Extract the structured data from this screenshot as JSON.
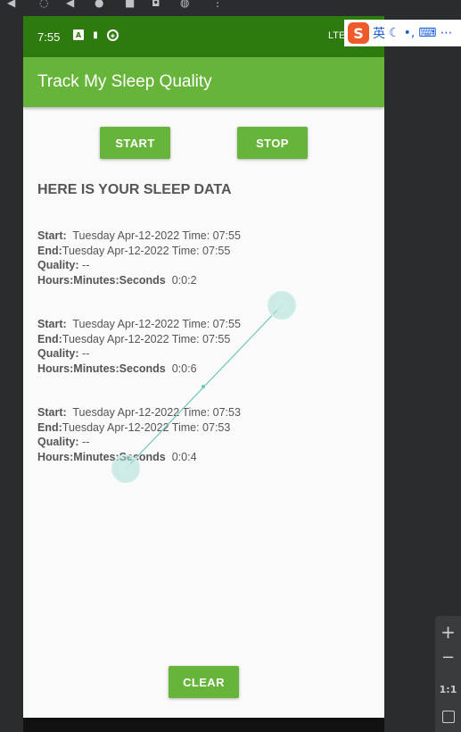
{
  "status_bar": {
    "time": "7:55",
    "network": "LTE",
    "icons": [
      "a-notification-icon",
      "sd-card-icon",
      "sync-icon"
    ]
  },
  "app_bar": {
    "title": "Track My Sleep Quality"
  },
  "buttons": {
    "start": "START",
    "stop": "STOP",
    "clear": "CLEAR"
  },
  "heading": "HERE IS YOUR SLEEP DATA",
  "labels": {
    "start": "Start:",
    "end": "End:",
    "quality": "Quality:",
    "duration": "Hours:Minutes:Seconds"
  },
  "records": [
    {
      "start": "Tuesday Apr-12-2022 Time: 07:55",
      "end": "Tuesday Apr-12-2022 Time: 07:55",
      "quality": "--",
      "duration": "0:0:2"
    },
    {
      "start": "Tuesday Apr-12-2022 Time: 07:55",
      "end": "Tuesday Apr-12-2022 Time: 07:55",
      "quality": "--",
      "duration": "0:0:6"
    },
    {
      "start": "Tuesday Apr-12-2022 Time: 07:53",
      "end": "Tuesday Apr-12-2022 Time: 07:53",
      "quality": "--",
      "duration": "0:0:4"
    }
  ],
  "ime_toolbar": {
    "logo": "S",
    "language": "英"
  },
  "zoom_controls": {
    "zoom_in": "+",
    "zoom_out": "−",
    "actual_size": "1:1"
  },
  "colors": {
    "status_bar": "#2d7a0f",
    "app_bar": "#67b43a",
    "button": "#67b43a",
    "gesture": "#6fc7b4"
  }
}
